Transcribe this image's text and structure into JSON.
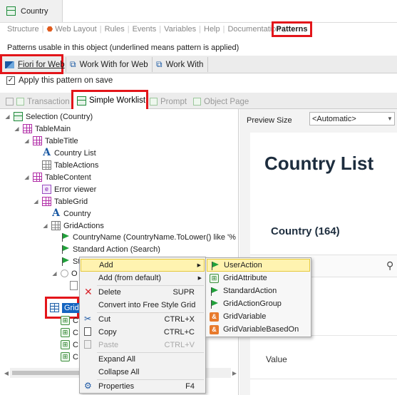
{
  "document_tab": {
    "title": "Country"
  },
  "section_tabs": [
    "Structure",
    "Web Layout",
    "Rules",
    "Events",
    "Variables",
    "Help",
    "Documentation",
    "Patterns"
  ],
  "hint": "Patterns usable in this object (underlined means pattern is applied)",
  "pattern_tabs": [
    "Fiori for Web",
    "Work With for Web",
    "Work With"
  ],
  "apply_checkbox": {
    "label": "Apply this pattern on save",
    "checked": true
  },
  "instance_tabs": [
    "Transaction",
    "Simple Worklist",
    "Prompt",
    "Object Page"
  ],
  "tree": {
    "selection": "Selection (Country)",
    "table_main": "TableMain",
    "table_title": "TableTitle",
    "country_list": "Country List",
    "table_actions": "TableActions",
    "table_content": "TableContent",
    "error_viewer": "Error viewer",
    "table_grid": "TableGrid",
    "country": "Country",
    "grid_actions": "GridActions",
    "country_name_filter": "CountryName (CountryName.ToLower() like '%",
    "standard_action": "Standard Action (Search)",
    "partial_st": "St",
    "partial_o": "O",
    "grid": "Grid",
    "partial_c": "C"
  },
  "preview": {
    "size_label": "Preview Size",
    "size_value": "<Automatic>",
    "title": "Country List",
    "count": "Country (164)",
    "value_label": "Value"
  },
  "context_menu": {
    "add": "Add",
    "add_default": "Add (from default)",
    "delete": "Delete",
    "delete_shortcut": "SUPR",
    "convert": "Convert into Free Style Grid",
    "cut": "Cut",
    "cut_shortcut": "CTRL+X",
    "copy": "Copy",
    "copy_shortcut": "CTRL+C",
    "paste": "Paste",
    "paste_shortcut": "CTRL+V",
    "expand_all": "Expand All",
    "collapse_all": "Collapse All",
    "properties": "Properties",
    "properties_shortcut": "F4"
  },
  "submenu": [
    "UserAction",
    "GridAttribute",
    "StandardAction",
    "GridActionGroup",
    "GridVariable",
    "GridVariableBasedOn"
  ],
  "colors": {
    "highlight_box": "#e3151a",
    "menu_highlight": "#fff3b0",
    "selection": "#1565c0"
  }
}
